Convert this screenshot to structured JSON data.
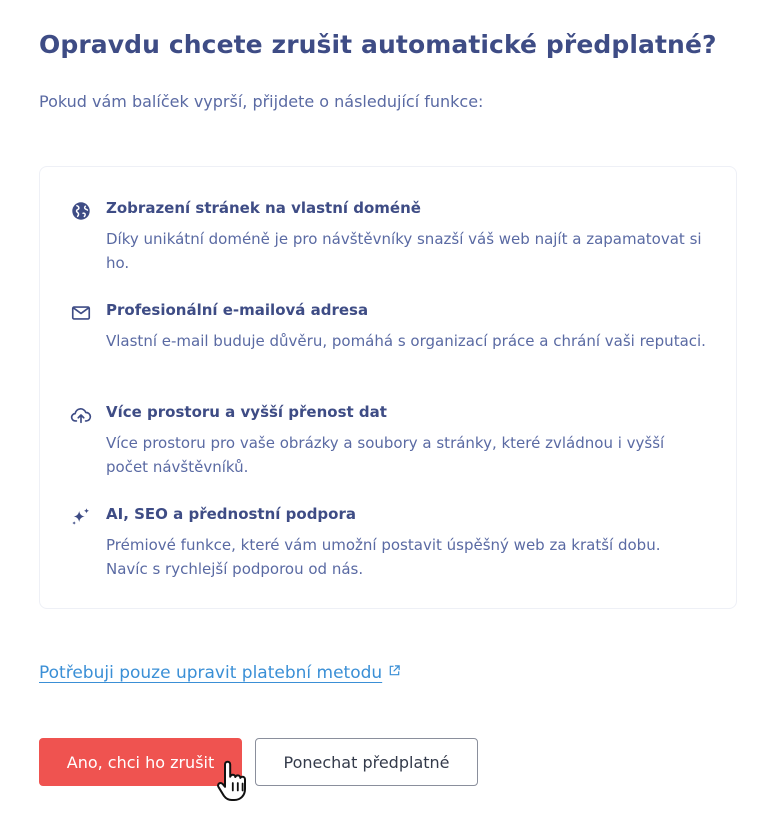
{
  "dialog": {
    "title": "Opravdu chcete zrušit automatické předplatné?",
    "subtitle": "Pokud vám balíček vyprší, přijdete o následující funkce:"
  },
  "features": [
    {
      "icon": "globe-icon",
      "title": "Zobrazení stránek na vlastní doméně",
      "description": "Díky unikátní doméně je pro návštěvníky snazší váš web najít a zapamatovat si ho."
    },
    {
      "icon": "mail-icon",
      "title": "Profesionální e-mailová adresa",
      "description": "Vlastní e-mail buduje důvěru, pomáhá s organizací práce a chrání vaši reputaci."
    },
    {
      "icon": "cloud-upload-icon",
      "title": "Více prostoru a vyšší přenost dat",
      "description": "Více prostoru pro vaše obrázky a soubory a stránky, které zvládnou i vyšší počet návštěvníků."
    },
    {
      "icon": "sparkles-icon",
      "title": "AI, SEO a přednostní podpora",
      "description": "Prémiové funkce, které vám umožní postavit úspěšný web za kratší dobu. Navíc s rychlejší podporou od nás."
    }
  ],
  "links": {
    "payment_method": "Potřebuji pouze upravit platební metodu",
    "payment_method_icon": "external-link-icon"
  },
  "actions": {
    "confirm_cancel": "Ano, chci ho zrušit",
    "keep_subscription": "Ponechat předplatné"
  },
  "colors": {
    "heading": "#3e4c85",
    "body_text": "#5a6aa3",
    "link": "#3a8fd6",
    "danger": "#ef5350",
    "border": "#eef0f6"
  }
}
